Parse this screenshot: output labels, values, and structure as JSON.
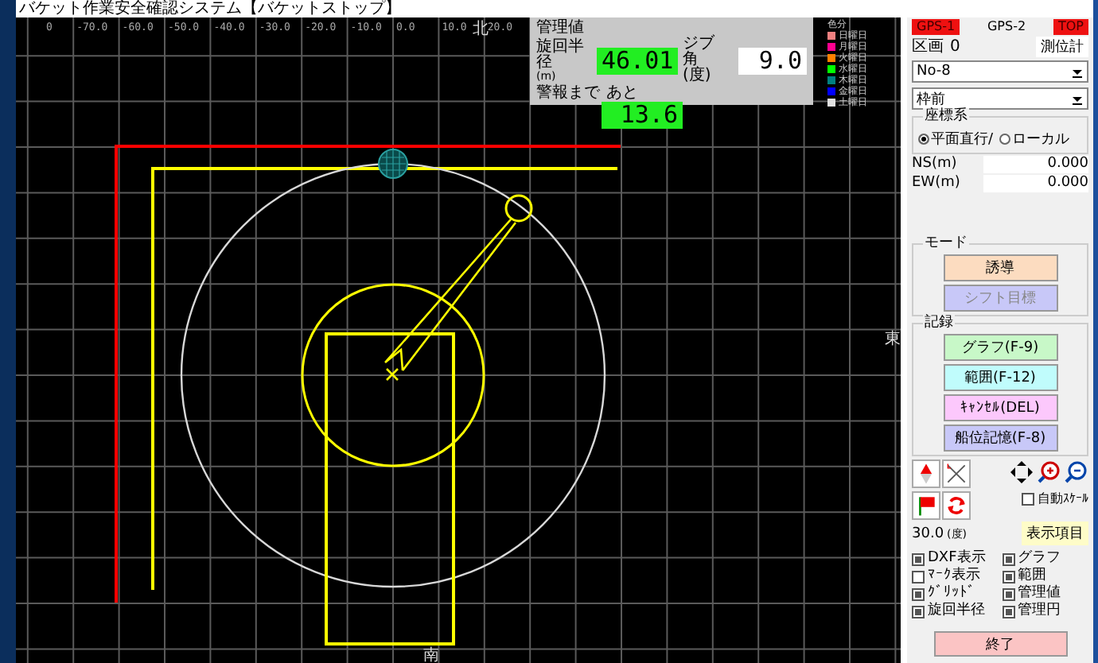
{
  "window": {
    "title": "バケット作業安全確認システム【バケットストップ】"
  },
  "canvas": {
    "x_ticks": [
      "0",
      "-70.0",
      "-60.0",
      "-50.0",
      "-40.0",
      "-30.0",
      "-20.0",
      "-10.0",
      "0.0",
      "10.0",
      "20.0"
    ],
    "north": "北",
    "east": "東",
    "south": "南"
  },
  "management": {
    "title": "管理値",
    "radius_label": "旋回半径",
    "radius_unit": "(m)",
    "radius_value": "46.01",
    "jib_label": "ジブ角",
    "jib_unit": "(度)",
    "jib_value": "9.0",
    "alarm_label": "警報まで",
    "remain_label": "あと",
    "remain_value": "13.6"
  },
  "legend": {
    "title": "色分",
    "items": [
      {
        "label": "日曜日",
        "color": "#f08080"
      },
      {
        "label": "月曜日",
        "color": "#ff0090"
      },
      {
        "label": "火曜日",
        "color": "#ff8000"
      },
      {
        "label": "水曜日",
        "color": "#00ff00"
      },
      {
        "label": "木曜日",
        "color": "#008080"
      },
      {
        "label": "金曜日",
        "color": "#0000ff"
      },
      {
        "label": "土曜日",
        "color": "#e0e0e0"
      }
    ]
  },
  "panel": {
    "gps": [
      {
        "label": "GPS-1",
        "alert": true
      },
      {
        "label": "GPS-2",
        "alert": false
      },
      {
        "label": "TOP",
        "alert": true
      }
    ],
    "section_label": "区画",
    "section_value": "0",
    "positioner": "測位計",
    "dropdowns": [
      "No-8",
      "枠前"
    ],
    "coord": {
      "title": "座標系",
      "options": [
        {
          "label": "平面直行/",
          "selected": true
        },
        {
          "label": "ローカル",
          "selected": false
        }
      ]
    },
    "ns_label": "NS(m)",
    "ns_value": "0.000",
    "ew_label": "EW(m)",
    "ew_value": "0.000",
    "mode": {
      "title": "モード",
      "buttons": [
        {
          "label": "誘導",
          "color": "#fcdcc0",
          "disabled": false
        },
        {
          "label": "シフト目標",
          "color": "#c8c8f8",
          "disabled": true
        }
      ]
    },
    "record": {
      "title": "記録",
      "buttons": [
        {
          "label": "グラフ(F-9)",
          "color": "#c8f8c8"
        },
        {
          "label": "範囲(F-12)",
          "color": "#c0fcfc"
        },
        {
          "label": "ｷｬﾝｾﾙ(DEL)",
          "color": "#fcc8fc"
        },
        {
          "label": "船位記憶(F-8)",
          "color": "#c8c8f8"
        }
      ]
    },
    "auto_scale": {
      "label": "自動ｽｹｰﾙ",
      "checked": false
    },
    "angle_value": "30.0",
    "angle_unit": "(度)",
    "display_button": "表示項目",
    "display_items": [
      {
        "label": "DXF表示",
        "checked": true
      },
      {
        "label": "グラフ",
        "checked": true
      },
      {
        "label": "ﾏｰｸ表示",
        "checked": false
      },
      {
        "label": "範囲",
        "checked": true
      },
      {
        "label": "ｸﾞﾘｯﾄﾞ",
        "checked": true
      },
      {
        "label": "管理値",
        "checked": true
      },
      {
        "label": "旋回半径",
        "checked": true
      },
      {
        "label": "管理円",
        "checked": true
      }
    ],
    "exit_button": "終了"
  }
}
